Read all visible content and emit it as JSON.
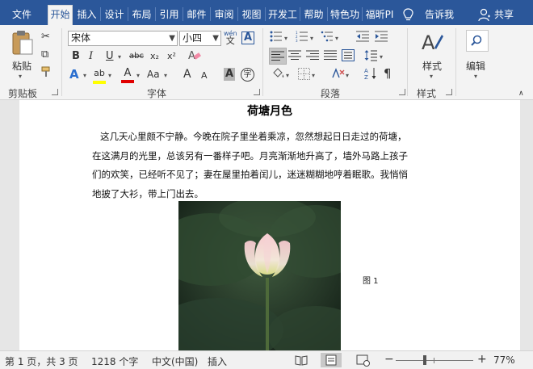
{
  "tabs": {
    "file": "文件",
    "home": "开始",
    "insert": "插入",
    "design": "设计",
    "layout": "布局",
    "references": "引用",
    "mailings": "邮件",
    "review": "审阅",
    "view": "视图",
    "developer": "开发工",
    "help": "帮助",
    "special": "特色功",
    "foxit": "福昕PI",
    "tell_me": "告诉我",
    "share": "共享"
  },
  "ribbon": {
    "clipboard": {
      "paste_label": "粘贴",
      "group_label": "剪贴板"
    },
    "font": {
      "group_label": "字体",
      "font_name": "宋体",
      "font_size": "小四",
      "phonetic": "wén",
      "bold": "B",
      "italic": "I",
      "underline": "U",
      "strike": "abc",
      "subscript": "x₂",
      "superscript": "x²",
      "text_effect": "A",
      "highlight": "ab",
      "font_color": "A",
      "aa_case": "Aa",
      "grow": "A",
      "shrink": "A",
      "char_shading": "A",
      "enclose": "字",
      "border_char": "A"
    },
    "paragraph": {
      "group_label": "段落"
    },
    "styles": {
      "label": "样式",
      "group_label": "样式"
    },
    "editing": {
      "label": "编辑"
    }
  },
  "document": {
    "title": "荷塘月色",
    "lines": [
      "这几天心里颇不宁静。今晚在院子里坐着乘凉，忽然想起日日走过的荷塘，",
      "在这满月的光里，总该另有一番样子吧。月亮渐渐地升高了，墙外马路上孩子",
      "们的欢笑，已经听不见了；妻在屋里拍着闰儿，迷迷糊糊地哼着眠歌。我悄悄",
      "地披了大衫，带上门出去。"
    ],
    "caption": "图 1"
  },
  "status": {
    "page": "第 1 页，共 3 页",
    "words": "1218 个字",
    "language": "中文(中国)",
    "mode": "插入",
    "zoom": "77%",
    "zoom_level": 0.77
  },
  "colors": {
    "tab_bar": "#2b579a",
    "highlight_yellow": "#ffff00",
    "font_red": "#e00000",
    "ribbon_bg": "#f3f3f3"
  }
}
